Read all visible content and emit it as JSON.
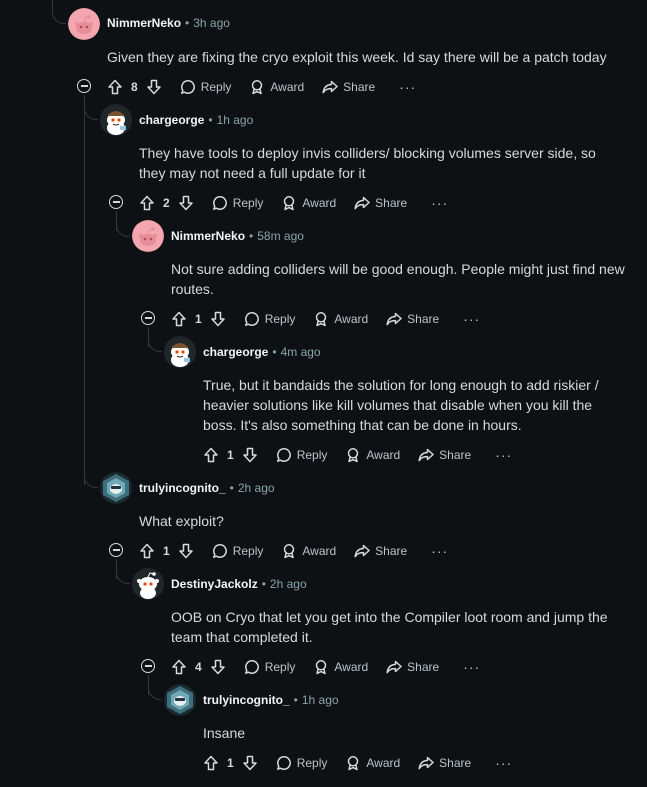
{
  "labels": {
    "reply": "Reply",
    "award": "Award",
    "share": "Share",
    "more": "···",
    "sep": "•"
  },
  "comments": [
    {
      "author": "NimmerNeko",
      "time": "3h ago",
      "body": "Given they are fixing the cryo exploit this week. Id say there will be a patch today",
      "votes": "8"
    },
    {
      "author": "chargeorge",
      "time": "1h ago",
      "body": "They have tools to deploy invis colliders/ blocking volumes server side, so they may not need a full update for it",
      "votes": "2"
    },
    {
      "author": "NimmerNeko",
      "time": "58m ago",
      "body": "Not sure adding colliders will be good enough. People might just find new routes.",
      "votes": "1"
    },
    {
      "author": "chargeorge",
      "time": "4m ago",
      "body": "True, but it bandaids the solution for long enough to add riskier / heavier solutions like kill volumes that disable when you kill the boss. It's also something that can be done in hours.",
      "votes": "1"
    },
    {
      "author": "trulyincognito_",
      "time": "2h ago",
      "body": "What exploit?",
      "votes": "1"
    },
    {
      "author": "DestinyJackolz",
      "time": "2h ago",
      "body": "OOB on Cryo that let you get into the Compiler loot room and jump the team that completed it.",
      "votes": "4"
    },
    {
      "author": "trulyincognito_",
      "time": "1h ago",
      "body": "Insane",
      "votes": "1"
    }
  ],
  "colors": {
    "background": "#0e1113",
    "text": "#d7dadc",
    "muted": "#8ba2ad",
    "thread_line": "#33383c",
    "pink_avatar": "#f4a6b0"
  },
  "icons": [
    "upvote-icon",
    "downvote-icon",
    "reply-icon",
    "award-icon",
    "share-icon",
    "collapse-icon",
    "more-icon"
  ]
}
